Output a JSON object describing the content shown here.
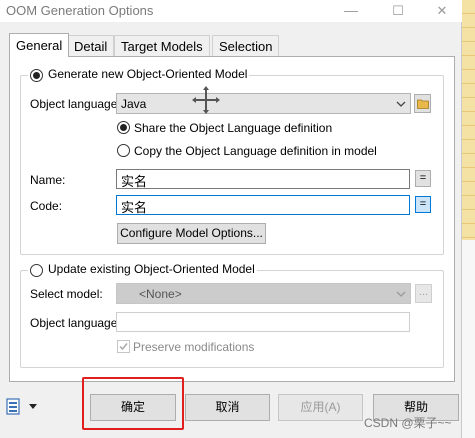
{
  "window": {
    "title": "OOM Generation Options",
    "minimize_glyph": "—",
    "maximize_glyph": "☐",
    "close_glyph": "✕"
  },
  "tabs": [
    {
      "label": "General",
      "active": true
    },
    {
      "label": "Detail",
      "active": false
    },
    {
      "label": "Target Models",
      "active": false
    },
    {
      "label": "Selection",
      "active": false
    }
  ],
  "generate_new": {
    "radio_label": "Generate new Object-Oriented Model",
    "selected": true,
    "object_language_label": "Object language:",
    "object_language_value": "Java",
    "share_definition_label": "Share the Object Language definition",
    "share_definition_selected": true,
    "copy_definition_label": "Copy the Object Language definition in model",
    "copy_definition_selected": false,
    "name_label": "Name:",
    "name_value": "实名",
    "name_button_glyph": "=",
    "code_label": "Code:",
    "code_value": "实名",
    "code_button_glyph": "=",
    "configure_button": "Configure Model Options..."
  },
  "update_existing": {
    "radio_label": "Update existing Object-Oriented Model",
    "selected": false,
    "select_model_label": "Select model:",
    "select_model_value": "<None>",
    "browse_glyph": "...",
    "object_language_label": "Object language:",
    "object_language_value": "",
    "preserve_label": "Preserve modifications",
    "preserve_checked": true
  },
  "footer": {
    "buttons": [
      {
        "label": "确定",
        "enabled": true,
        "highlighted": true
      },
      {
        "label": "取消",
        "enabled": true,
        "highlighted": false
      },
      {
        "label": "应用(A)",
        "enabled": false,
        "highlighted": false
      },
      {
        "label": "帮助",
        "enabled": true,
        "highlighted": false
      }
    ],
    "watermark": "CSDN @栗子~~"
  },
  "colors": {
    "focus_blue": "#0078d7",
    "highlight_red": "#e02020",
    "folder_yellow": "#e8b84a"
  }
}
